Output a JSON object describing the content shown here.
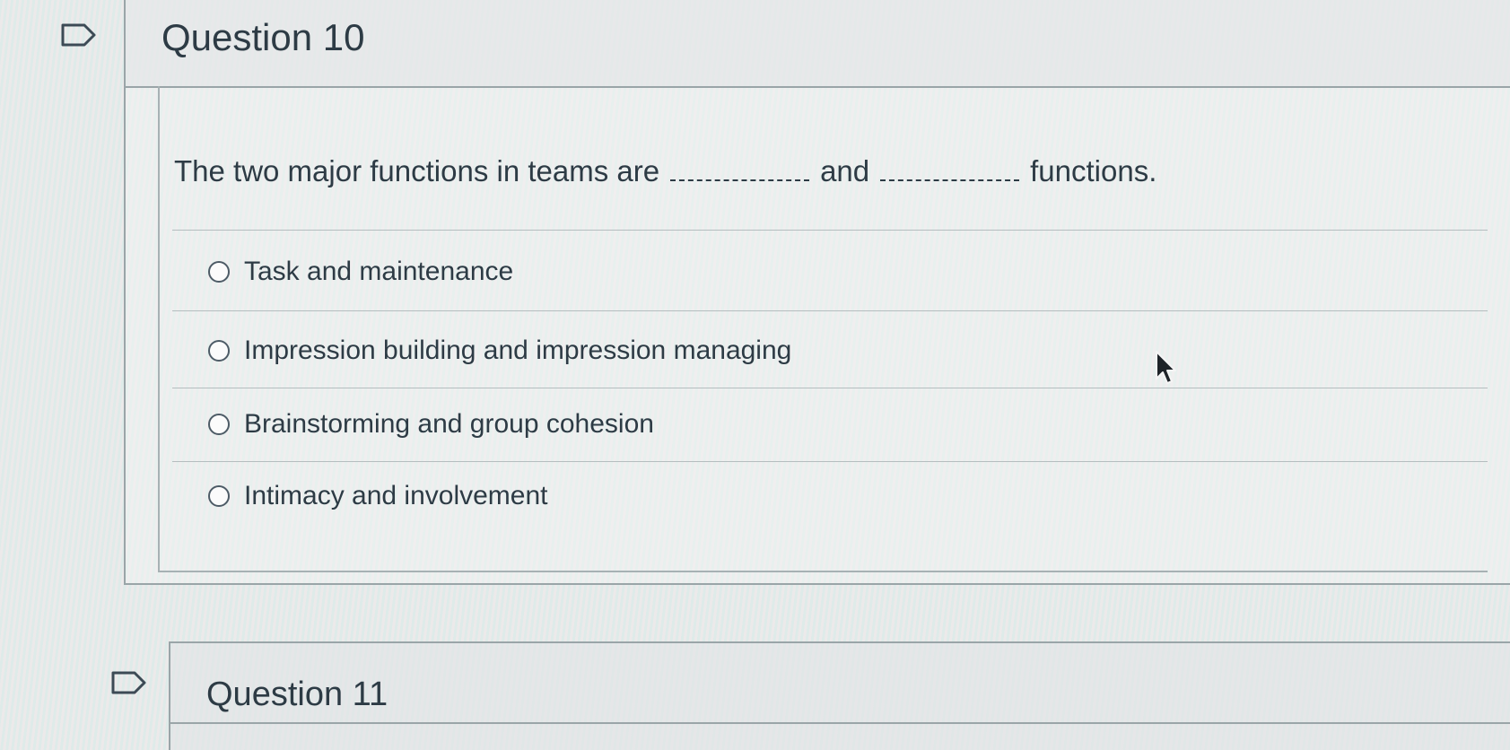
{
  "question_10": {
    "title": "Question 10",
    "text_before_first_blank": "The two major functions in teams are",
    "text_between_blanks": "and",
    "text_after_second_blank": "functions.",
    "answers": [
      {
        "label": "Task and maintenance",
        "selected": false
      },
      {
        "label": "Impression building and impression managing",
        "selected": false
      },
      {
        "label": "Brainstorming and group cohesion",
        "selected": false
      },
      {
        "label": "Intimacy and involvement",
        "selected": false
      }
    ]
  },
  "question_11": {
    "title": "Question 11"
  },
  "icons": {
    "flag": "flag-question-icon",
    "cursor": "mouse-cursor-icon"
  }
}
